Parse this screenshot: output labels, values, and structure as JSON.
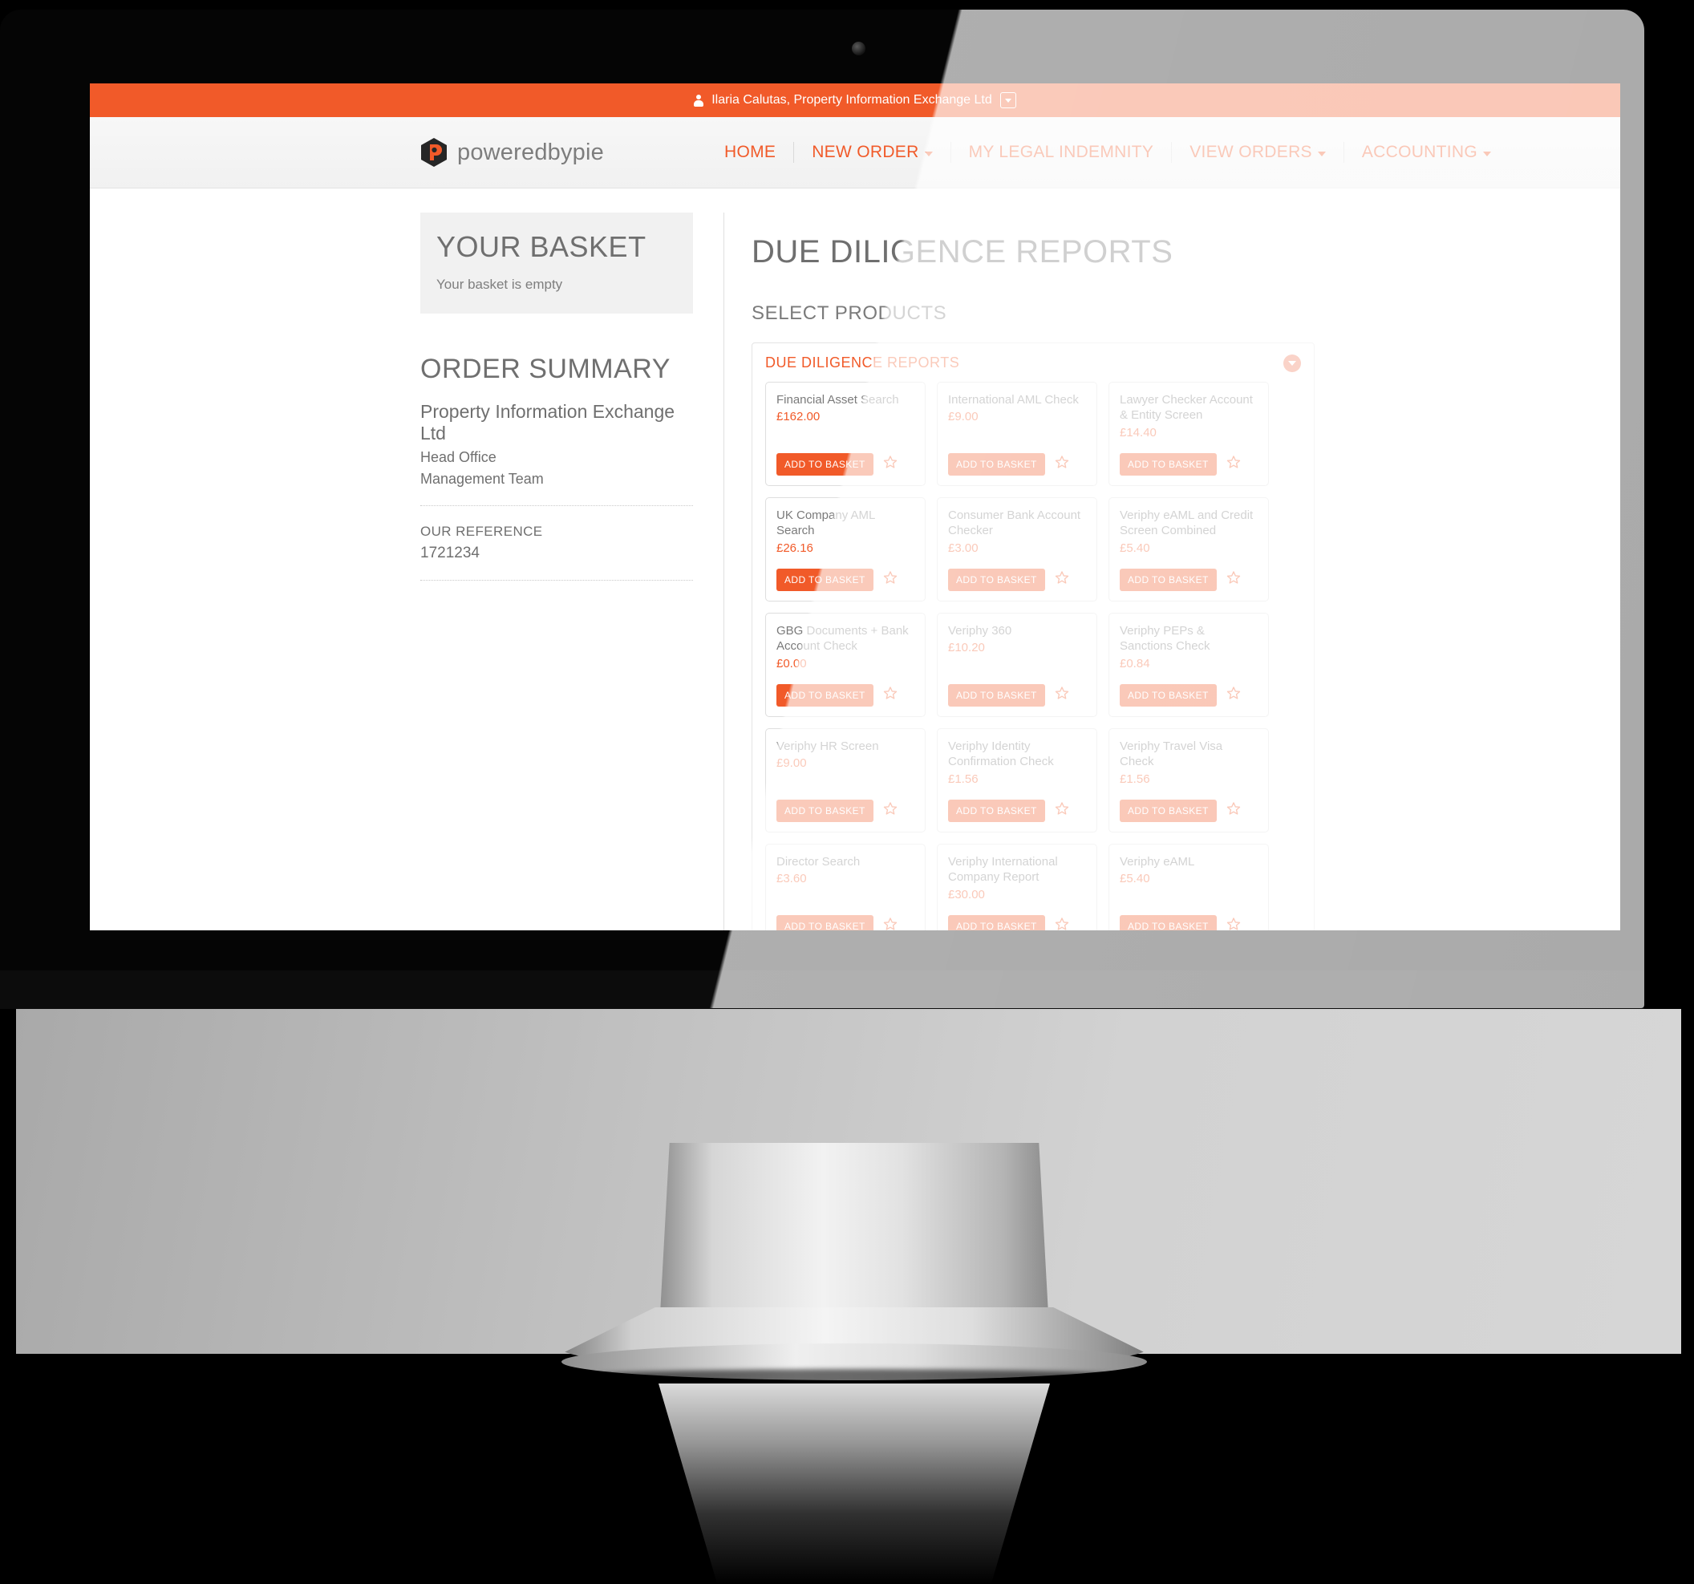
{
  "topbar": {
    "user_text": "Ilaria Calutas, Property Information Exchange Ltd",
    "person_icon": "person-icon",
    "dropdown_icon": "caret-down-box-icon"
  },
  "brand": {
    "logo_icon": "poweredbypie-hexagon-logo",
    "wordmark": "poweredbypie"
  },
  "nav": {
    "items": [
      {
        "label": "HOME",
        "has_caret": false
      },
      {
        "label": "NEW ORDER",
        "has_caret": true
      },
      {
        "label": "MY LEGAL INDEMNITY",
        "has_caret": false
      },
      {
        "label": "VIEW ORDERS",
        "has_caret": true
      },
      {
        "label": "ACCOUNTING",
        "has_caret": true
      }
    ]
  },
  "sidebar": {
    "basket_title": "YOUR BASKET",
    "basket_empty": "Your basket is empty",
    "summary_title": "ORDER SUMMARY",
    "company": "Property Information Exchange Ltd",
    "office": "Head Office",
    "team": "Management Team",
    "reference_label": "OUR REFERENCE",
    "reference_value": "1721234"
  },
  "main": {
    "heading": "DUE DILIGENCE REPORTS",
    "subheading": "SELECT PRODUCTS",
    "panel_title": "DUE DILIGENCE REPORTS",
    "collapse_icon": "chevron-down-circle-icon",
    "add_to_basket_label": "ADD TO BASKET",
    "favourite_icon": "star-outline-icon",
    "products": [
      {
        "name": "Financial Asset Search",
        "price": "£162.00"
      },
      {
        "name": "International AML Check",
        "price": "£9.00"
      },
      {
        "name": "Lawyer Checker Account & Entity Screen",
        "price": "£14.40"
      },
      {
        "name": "UK Company AML Search",
        "price": "£26.16"
      },
      {
        "name": "Consumer Bank Account Checker",
        "price": "£3.00"
      },
      {
        "name": "Veriphy eAML and Credit Screen Combined",
        "price": "£5.40"
      },
      {
        "name": "GBG Documents + Bank Account Check",
        "price": "£0.00"
      },
      {
        "name": "Veriphy 360",
        "price": "£10.20"
      },
      {
        "name": "Veriphy PEPs & Sanctions Check",
        "price": "£0.84"
      },
      {
        "name": "Veriphy HR Screen",
        "price": "£9.00"
      },
      {
        "name": "Veriphy Identity Confirmation Check",
        "price": "£1.56"
      },
      {
        "name": "Veriphy Travel Visa Check",
        "price": "£1.56"
      },
      {
        "name": "Director Search",
        "price": "£3.60"
      },
      {
        "name": "Veriphy International Company Report",
        "price": "£30.00"
      },
      {
        "name": "Veriphy eAML",
        "price": "£5.40"
      }
    ]
  },
  "colors": {
    "accent": "#f15a29",
    "accent_faded": "#f7a98f",
    "text_grey": "#6f6f6f",
    "bezel": "#050505"
  }
}
